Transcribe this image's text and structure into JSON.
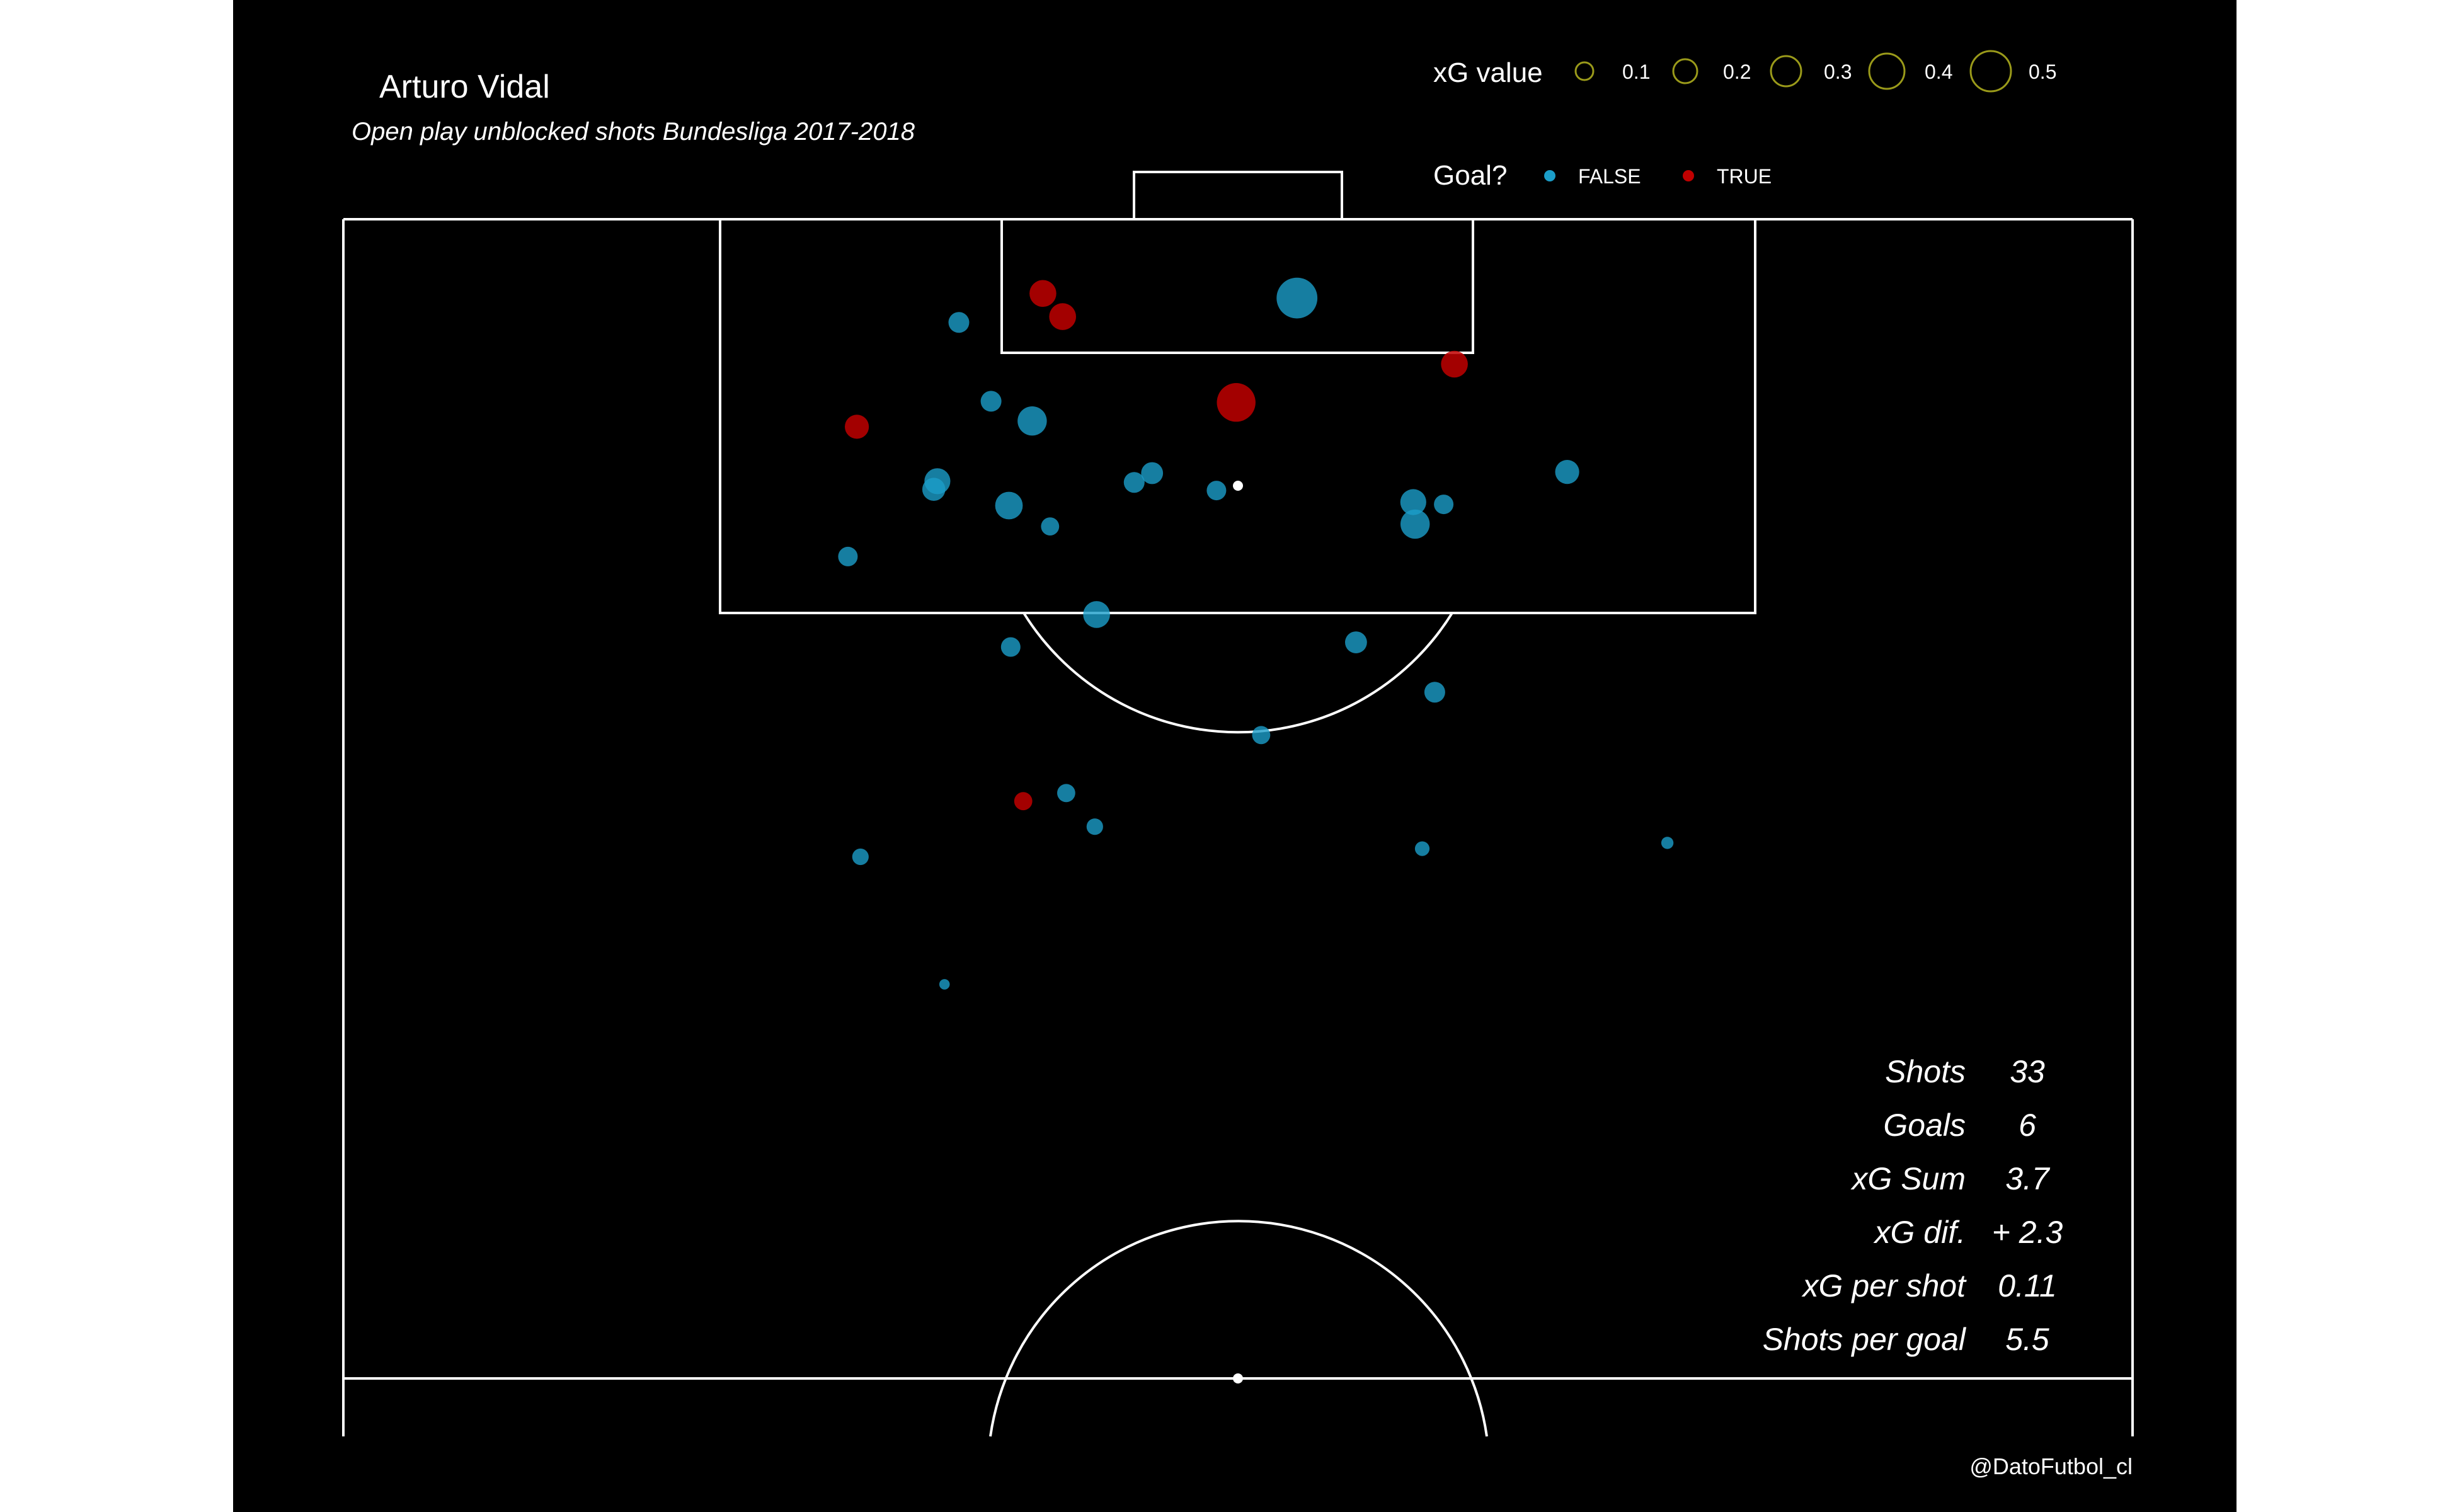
{
  "title": "Arturo Vidal",
  "subtitle": "Open play unblocked shots Bundesliga 2017-2018",
  "credit": "@DatoFutbol_cl",
  "colors": {
    "background": "#000000",
    "pitch_lines": "#ffffff",
    "goal_false": "#1b9ec9",
    "goal_true": "#c00000",
    "size_legend_ring": "#9a9a1a"
  },
  "legend": {
    "size": {
      "title": "xG value",
      "items": [
        {
          "label": "0.1",
          "value": 0.1
        },
        {
          "label": "0.2",
          "value": 0.2
        },
        {
          "label": "0.3",
          "value": 0.3
        },
        {
          "label": "0.4",
          "value": 0.4
        },
        {
          "label": "0.5",
          "value": 0.5
        }
      ]
    },
    "color": {
      "title": "Goal?",
      "items": [
        {
          "label": "FALSE",
          "color": "#1b9ec9"
        },
        {
          "label": "TRUE",
          "color": "#c00000"
        }
      ]
    }
  },
  "stats": [
    {
      "label": "Shots",
      "value": "33"
    },
    {
      "label": "Goals",
      "value": "6"
    },
    {
      "label": "xG Sum",
      "value": "3.7"
    },
    {
      "label": "xG dif.",
      "value": "+ 2.3"
    },
    {
      "label": "xG per shot",
      "value": "0.11"
    },
    {
      "label": "Shots per goal",
      "value": "5.5"
    }
  ],
  "chart_data": {
    "type": "scatter",
    "x_unit": "pitch width (0 = left touchline, 100 = right touchline)",
    "y_unit": "distance from goal line (0 = goal line, 100 = halfway line)",
    "size_field": "xG",
    "color_field": "goal",
    "points": [
      {
        "x": 39.1,
        "y": 6.4,
        "xg": 0.12,
        "goal": true
      },
      {
        "x": 40.2,
        "y": 8.4,
        "xg": 0.12,
        "goal": true
      },
      {
        "x": 53.3,
        "y": 6.8,
        "xg": 0.34,
        "goal": false
      },
      {
        "x": 34.4,
        "y": 8.9,
        "xg": 0.06,
        "goal": false
      },
      {
        "x": 62.1,
        "y": 12.5,
        "xg": 0.12,
        "goal": true
      },
      {
        "x": 49.9,
        "y": 15.8,
        "xg": 0.3,
        "goal": true
      },
      {
        "x": 28.7,
        "y": 17.9,
        "xg": 0.09,
        "goal": true
      },
      {
        "x": 36.2,
        "y": 15.7,
        "xg": 0.06,
        "goal": false
      },
      {
        "x": 38.5,
        "y": 17.4,
        "xg": 0.15,
        "goal": false
      },
      {
        "x": 33.2,
        "y": 22.6,
        "xg": 0.11,
        "goal": false
      },
      {
        "x": 33.0,
        "y": 23.3,
        "xg": 0.08,
        "goal": false
      },
      {
        "x": 37.2,
        "y": 24.7,
        "xg": 0.13,
        "goal": false
      },
      {
        "x": 39.5,
        "y": 26.5,
        "xg": 0.04,
        "goal": false
      },
      {
        "x": 44.2,
        "y": 22.7,
        "xg": 0.06,
        "goal": false
      },
      {
        "x": 45.2,
        "y": 21.9,
        "xg": 0.07,
        "goal": false
      },
      {
        "x": 48.8,
        "y": 23.4,
        "xg": 0.05,
        "goal": false
      },
      {
        "x": 59.8,
        "y": 24.4,
        "xg": 0.11,
        "goal": false
      },
      {
        "x": 61.5,
        "y": 24.6,
        "xg": 0.05,
        "goal": false
      },
      {
        "x": 59.9,
        "y": 26.3,
        "xg": 0.15,
        "goal": false
      },
      {
        "x": 68.4,
        "y": 21.8,
        "xg": 0.09,
        "goal": false
      },
      {
        "x": 28.2,
        "y": 29.1,
        "xg": 0.05,
        "goal": false
      },
      {
        "x": 42.1,
        "y": 34.1,
        "xg": 0.12,
        "goal": false
      },
      {
        "x": 37.3,
        "y": 36.9,
        "xg": 0.05,
        "goal": false
      },
      {
        "x": 56.6,
        "y": 36.5,
        "xg": 0.07,
        "goal": false
      },
      {
        "x": 61.0,
        "y": 40.8,
        "xg": 0.06,
        "goal": false
      },
      {
        "x": 51.3,
        "y": 44.5,
        "xg": 0.04,
        "goal": false
      },
      {
        "x": 40.4,
        "y": 49.5,
        "xg": 0.04,
        "goal": false
      },
      {
        "x": 38.0,
        "y": 50.2,
        "xg": 0.04,
        "goal": true
      },
      {
        "x": 42.0,
        "y": 52.4,
        "xg": 0.03,
        "goal": false
      },
      {
        "x": 28.9,
        "y": 55.0,
        "xg": 0.03,
        "goal": false
      },
      {
        "x": 60.3,
        "y": 54.3,
        "xg": 0.02,
        "goal": false
      },
      {
        "x": 74.0,
        "y": 53.8,
        "xg": 0.01,
        "goal": false
      },
      {
        "x": 33.6,
        "y": 66.0,
        "xg": 0.005,
        "goal": false
      }
    ]
  }
}
